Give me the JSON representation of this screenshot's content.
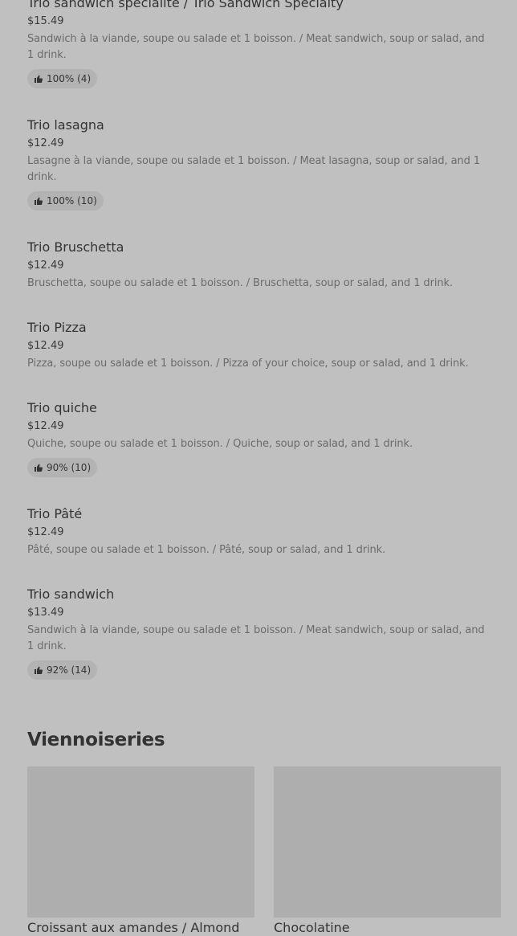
{
  "menu_items": [
    {
      "name": "Trio sandwich spécialité / Trio Sandwich Specialty",
      "price": "$15.49",
      "description": "Sandwich à la viande, soupe ou salade et 1 boisson. / Meat sandwich, soup or salad, and 1 drink.",
      "rating": "100% (4)"
    },
    {
      "name": "Trio lasagna",
      "price": "$12.49",
      "description": "Lasagne à la viande, soupe ou salade et 1 boisson. / Meat lasagna, soup or salad, and 1 drink.",
      "rating": "100% (10)"
    },
    {
      "name": "Trio Bruschetta",
      "price": "$12.49",
      "description": "Bruschetta, soupe ou salade et 1 boisson. / Bruschetta, soup or salad, and 1 drink."
    },
    {
      "name": "Trio Pizza",
      "price": "$12.49",
      "description": "Pizza, soupe ou salade et 1 boisson. / Pizza of your choice, soup or salad, and 1 drink."
    },
    {
      "name": "Trio quiche",
      "price": "$12.49",
      "description": "Quiche, soupe ou salade et 1 boisson. / Quiche, soup or salad, and 1 drink.",
      "rating": "90% (10)"
    },
    {
      "name": "Trio Pâté",
      "price": "$12.49",
      "description": "Pâté, soupe ou salade et 1 boisson. / Pâté, soup or salad, and 1 drink."
    },
    {
      "name": "Trio sandwich",
      "price": "$13.49",
      "description": "Sandwich à la viande, soupe ou salade et 1 boisson. / Meat sandwich, soup or salad, and 1 drink.",
      "rating": "92% (14)"
    }
  ],
  "section": {
    "title": "Viennoiseries"
  },
  "cards": [
    {
      "title": "Croissant aux amandes / Almond"
    },
    {
      "title": "Chocolatine"
    }
  ],
  "icons": {
    "rating": "thumbs-up-icon"
  }
}
